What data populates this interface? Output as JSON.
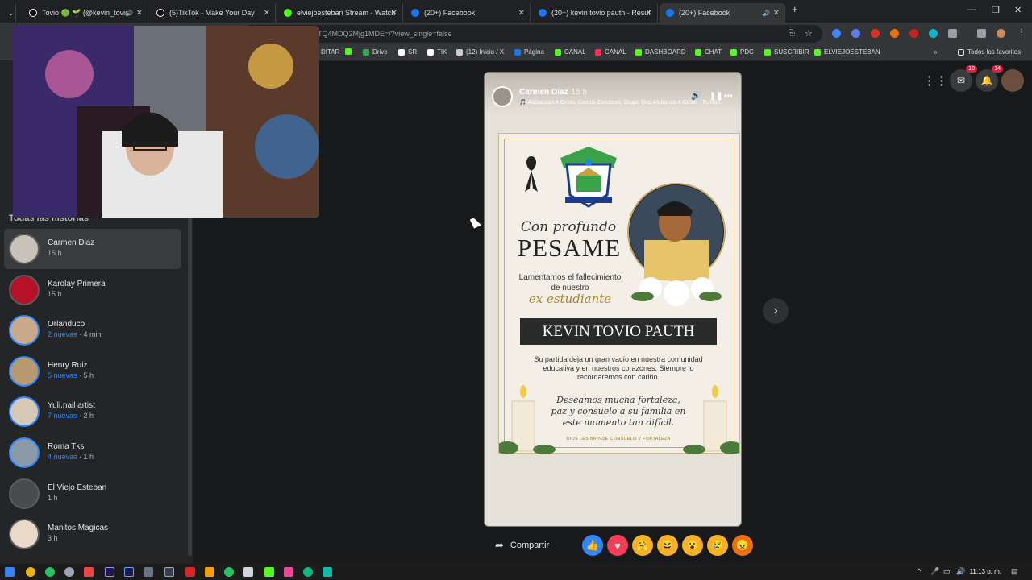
{
  "browser": {
    "tabs": [
      {
        "label": "Tovio 🟢 🌱 (@kevin_tovio",
        "icon": "tiktok-icon",
        "sound": true
      },
      {
        "label": "(5)TikTok - Make Your Day",
        "icon": "tiktok-icon",
        "sound": false
      },
      {
        "label": "elviejoesteban Stream - Watch",
        "icon": "kick-icon",
        "sound": false
      },
      {
        "label": "(20+) Facebook",
        "icon": "facebook-icon",
        "sound": false
      },
      {
        "label": "(20+) kevin tovio pauth - Resul",
        "icon": "facebook-icon",
        "sound": false
      },
      {
        "label": "(20+) Facebook",
        "icon": "facebook-icon",
        "sound": true,
        "active": true
      }
    ],
    "url_fragment": "TQ4MDQ2Mjg1MDE=/?view_single=false",
    "bookmarks": [
      "DITAR",
      "Drive",
      "SR",
      "TIK",
      "(12) Inicio / X",
      "Página",
      "CANAL",
      "CANAL",
      "DASHBOARD",
      "CHAT",
      "PDC",
      "SUSCRIBIR",
      "ELVIEJOESTEBAN"
    ],
    "all_bookmarks_label": "Todos los favoritos"
  },
  "sidebar": {
    "section_title": "Todas las historias",
    "stories": [
      {
        "name": "Carmen Diaz",
        "new": "",
        "time": "15 h",
        "active": true
      },
      {
        "name": "Karolay Primera",
        "new": "",
        "time": "15 h"
      },
      {
        "name": "Orlanduco",
        "new": "2 nuevas",
        "time": "4 min"
      },
      {
        "name": "Henry Ruiz",
        "new": "5 nuevas",
        "time": "5 h"
      },
      {
        "name": "Yuli.nail artist",
        "new": "7 nuevas",
        "time": "2 h"
      },
      {
        "name": "Roma Tks",
        "new": "4 nuevas",
        "time": "1 h"
      },
      {
        "name": "El Viejo Esteban",
        "new": "",
        "time": "1 h"
      },
      {
        "name": "Manitos Magicas",
        "new": "",
        "time": "3 h"
      }
    ]
  },
  "story_viewer": {
    "author": "Carmen Diaz",
    "time": "15 h",
    "song": "🎵 Alabanzas A Cristo, Cantos Catolicos, Grupo Una Alabanza A Cristo · Tu Has",
    "card": {
      "line1": "Con profundo",
      "line2": "PESAME",
      "line3": "Lamentamos el fallecimiento de nuestro",
      "line4": "ex estudiante",
      "name": "KEVIN TOVIO PAUTH",
      "message": "Su partida deja un gran vacío en nuestra comunidad educativa y en nuestros corazones. Siempre lo recordaremos con cariño.",
      "wish": "Deseamos mucha fortaleza, paz y consuelo a su familia en este momento tan difícil.",
      "footer": "DIOS LES BRINDE CONSUELO Y FORTALEZA",
      "crest_text": "INSTITUCIÓN EDUCATIVA",
      "crest_motto": "SOLIDARIDAD"
    },
    "share_label": "Compartir",
    "reactions": [
      "like",
      "love",
      "care",
      "haha",
      "wow",
      "sad",
      "angry"
    ]
  },
  "fb_header": {
    "messenger_badge": "10",
    "notifications_badge": "14"
  },
  "taskbar": {
    "clock": "11:13 p. m."
  },
  "colors": {
    "fb_blue": "#2d88ff",
    "bg": "#18191a",
    "sidebar": "#242526",
    "card_gold": "#c7a86b"
  }
}
